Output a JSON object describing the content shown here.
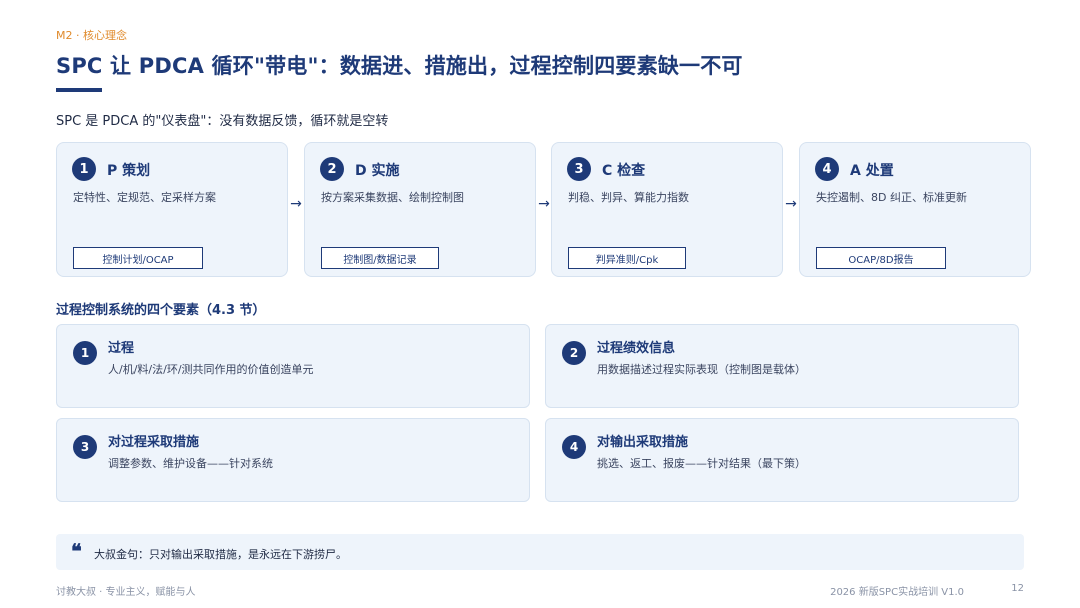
{
  "header": {
    "tag": "M2 · 核心理念",
    "title": "SPC 让 PDCA 循环\"带电\"：数据进、措施出，过程控制四要素缺一不可",
    "subtitle": "SPC 是 PDCA 的\"仪表盘\"：没有数据反馈，循环就是空转"
  },
  "pdca": [
    {
      "num": "1",
      "title": "P 策划",
      "desc": "定特性、定规范、定采样方案",
      "box": "控制计划/OCAP"
    },
    {
      "num": "2",
      "title": "D 实施",
      "desc": "按方案采集数据、绘制控制图",
      "box": "控制图/数据记录"
    },
    {
      "num": "3",
      "title": "C 检查",
      "desc": "判稳、判异、算能力指数",
      "box": "判异准则/Cpk"
    },
    {
      "num": "4",
      "title": "A 处置",
      "desc": "失控遏制、8D 纠正、标准更新",
      "box": "OCAP/8D报告"
    }
  ],
  "arrow_glyph": "→",
  "section_title": "过程控制系统的四个要素（4.3 节）",
  "elements": [
    {
      "num": "1",
      "title": "过程",
      "desc": "人/机/料/法/环/测共同作用的价值创造单元"
    },
    {
      "num": "2",
      "title": "过程绩效信息",
      "desc": "用数据描述过程实际表现（控制图是载体）"
    },
    {
      "num": "3",
      "title": "对过程采取措施",
      "desc": "调整参数、维护设备——针对系统"
    },
    {
      "num": "4",
      "title": "对输出采取措施",
      "desc": "挑选、返工、报废——针对结果（最下策）"
    }
  ],
  "quote": {
    "icon": "quote-icon",
    "mark": "❝",
    "text": "大叔金句：只对输出采取措施，是永远在下游捞尸。"
  },
  "footer": {
    "left": "讨教大叔 · 专业主义，赋能与人",
    "right": "2026 新版SPC实战培训 V1.0",
    "page": "12"
  },
  "colors": {
    "accent": "#1e3a78",
    "tag": "#e08a2b",
    "card_bg": "#eef4fb"
  }
}
